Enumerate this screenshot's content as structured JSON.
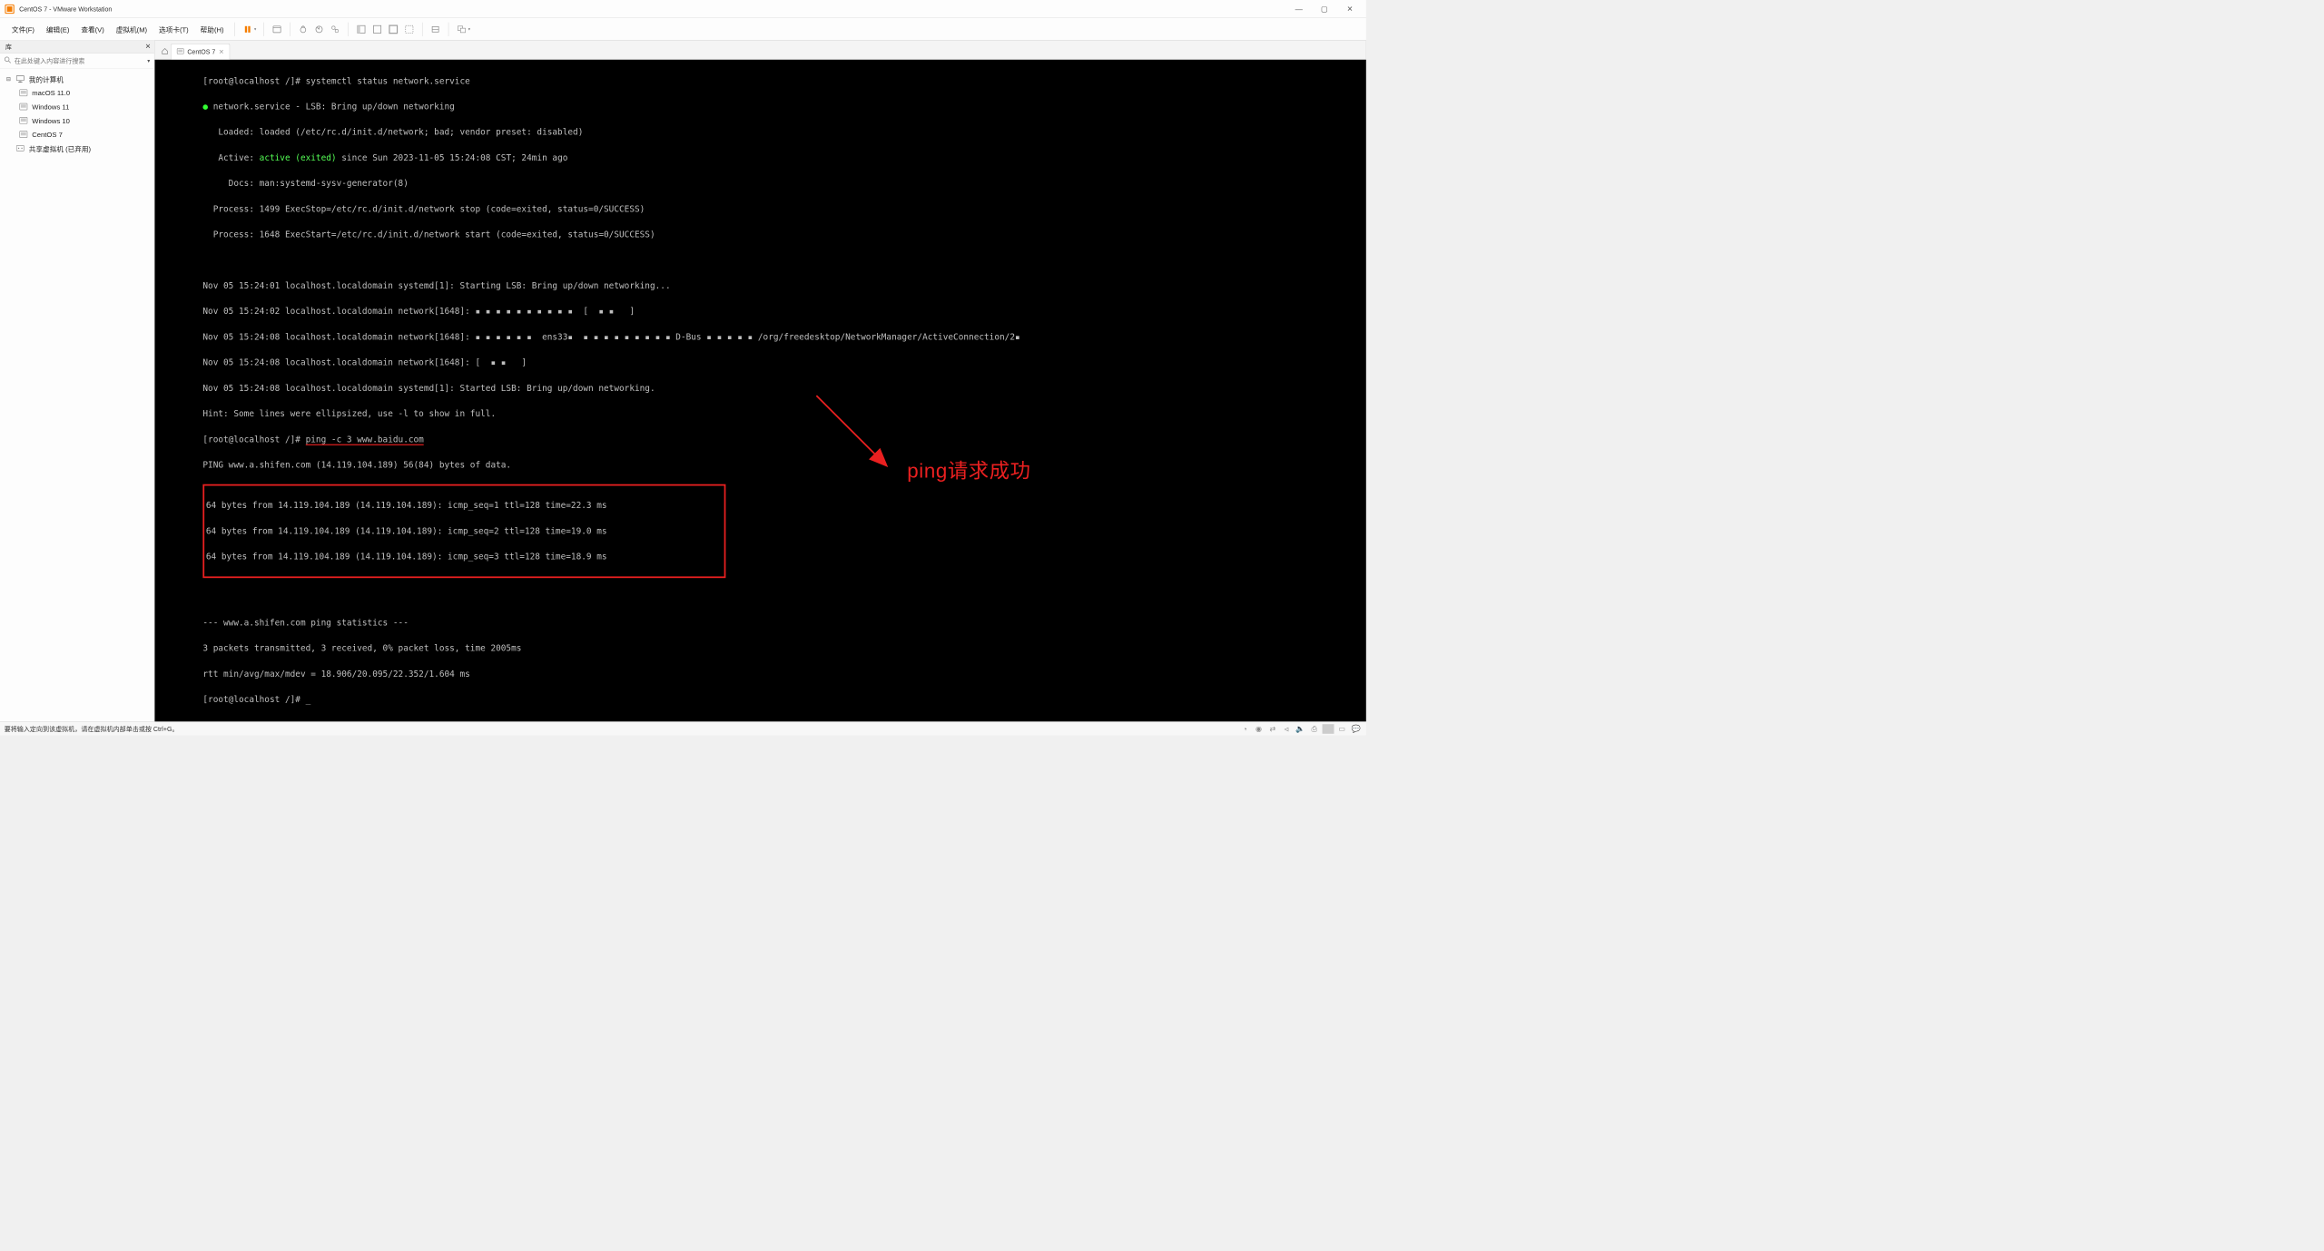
{
  "window": {
    "title": "CentOS 7 - VMware Workstation"
  },
  "menu": {
    "file": "文件(F)",
    "edit": "编辑(E)",
    "view": "查看(V)",
    "vm": "虚拟机(M)",
    "tabs": "选项卡(T)",
    "help": "帮助(H)"
  },
  "sidebar": {
    "title": "库",
    "search_placeholder": "在此处键入内容进行搜索",
    "root": "我的计算机",
    "items": [
      "macOS 11.0",
      "Windows 11",
      "Windows 10",
      "CentOS 7"
    ],
    "shared": "共享虚拟机 (已弃用)"
  },
  "tab": {
    "name": "CentOS 7"
  },
  "terminal": {
    "l1": "[root@localhost /]# systemctl status network.service",
    "l2a": "● ",
    "l2b": "network.service - LSB: Bring up/down networking",
    "l3": "   Loaded: loaded (/etc/rc.d/init.d/network; bad; vendor preset: disabled)",
    "l4a": "   Active: ",
    "l4b": "active (exited)",
    "l4c": " since Sun 2023-11-05 15:24:08 CST; 24min ago",
    "l5": "     Docs: man:systemd-sysv-generator(8)",
    "l6": "  Process: 1499 ExecStop=/etc/rc.d/init.d/network stop (code=exited, status=0/SUCCESS)",
    "l7": "  Process: 1648 ExecStart=/etc/rc.d/init.d/network start (code=exited, status=0/SUCCESS)",
    "l8": " ",
    "l9": "Nov 05 15:24:01 localhost.localdomain systemd[1]: Starting LSB: Bring up/down networking...",
    "l10": "Nov 05 15:24:02 localhost.localdomain network[1648]: ▪ ▪ ▪ ▪ ▪ ▪ ▪ ▪ ▪ ▪  [  ▪ ▪   ]",
    "l11": "Nov 05 15:24:08 localhost.localdomain network[1648]: ▪ ▪ ▪ ▪ ▪ ▪  ens33▪  ▪ ▪ ▪ ▪ ▪ ▪ ▪ ▪ ▪ D-Bus ▪ ▪ ▪ ▪ ▪ /org/freedesktop/NetworkManager/ActiveConnection/2▪",
    "l12": "Nov 05 15:24:08 localhost.localdomain network[1648]: [  ▪ ▪   ]",
    "l13": "Nov 05 15:24:08 localhost.localdomain systemd[1]: Started LSB: Bring up/down networking.",
    "l14": "Hint: Some lines were ellipsized, use -l to show in full.",
    "l15a": "[root@localhost /]# ",
    "l15b": "ping -c 3 www.baidu.com",
    "l16": "PING www.a.shifen.com (14.119.104.189) 56(84) bytes of data.",
    "p1": "64 bytes from 14.119.104.189 (14.119.104.189): icmp_seq=1 ttl=128 time=22.3 ms",
    "p2": "64 bytes from 14.119.104.189 (14.119.104.189): icmp_seq=2 ttl=128 time=19.0 ms",
    "p3": "64 bytes from 14.119.104.189 (14.119.104.189): icmp_seq=3 ttl=128 time=18.9 ms",
    "s0": " ",
    "s1": "--- www.a.shifen.com ping statistics ---",
    "s2": "3 packets transmitted, 3 received, 0% packet loss, time 2005ms",
    "s3": "rtt min/avg/max/mdev = 18.906/20.095/22.352/1.604 ms",
    "s4": "[root@localhost /]# _"
  },
  "annotation": "ping请求成功",
  "status": {
    "text": "要将输入定向到该虚拟机，请在虚拟机内部单击或按 Ctrl+G。"
  }
}
